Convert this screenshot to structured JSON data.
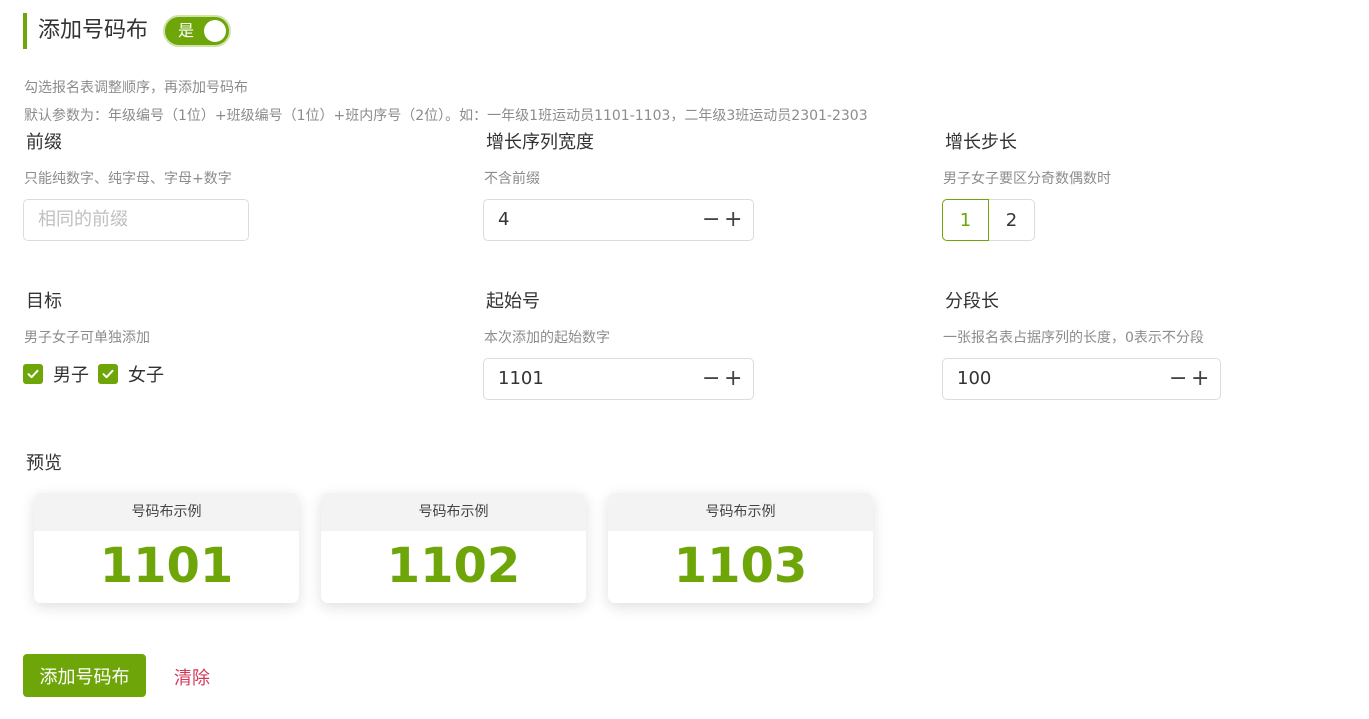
{
  "header": {
    "title": "添加号码布",
    "toggle_label": "是"
  },
  "hints": [
    "勾选报名表调整顺序，再添加号码布",
    "默认参数为：年级编号（1位）+班级编号（1位）+班内序号（2位）。如：一年级1班运动员1101-1103，二年级3班运动员2301-2303"
  ],
  "fields": {
    "prefix": {
      "label": "前缀",
      "desc": "只能纯数字、纯字母、字母+数字",
      "placeholder": "相同的前缀",
      "value": ""
    },
    "width": {
      "label": "增长序列宽度",
      "desc": "不含前缀",
      "value": "4"
    },
    "step": {
      "label": "增长步长",
      "desc": "男子女子要区分奇数偶数时",
      "options": [
        "1",
        "2"
      ],
      "selected": "1"
    },
    "target": {
      "label": "目标",
      "desc": "男子女子可单独添加",
      "options": [
        "男子",
        "女子"
      ]
    },
    "start": {
      "label": "起始号",
      "desc": "本次添加的起始数字",
      "value": "1101"
    },
    "segment": {
      "label": "分段长",
      "desc": "一张报名表占据序列的长度，0表示不分段",
      "value": "100"
    }
  },
  "stepper": {
    "minus": "−",
    "plus": "+"
  },
  "preview": {
    "label": "预览",
    "cards": [
      {
        "header": "号码布示例",
        "number": "1101"
      },
      {
        "header": "号码布示例",
        "number": "1102"
      },
      {
        "header": "号码布示例",
        "number": "1103"
      }
    ]
  },
  "actions": {
    "add": "添加号码布",
    "clear": "清除"
  },
  "colors": {
    "accent": "#6ea60a",
    "danger": "#d4395a"
  }
}
